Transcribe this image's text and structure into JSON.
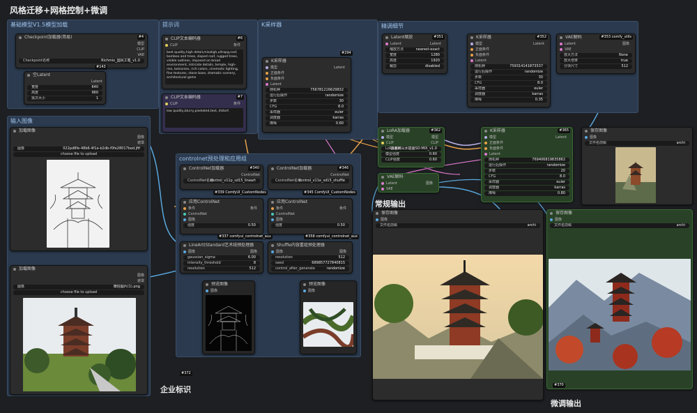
{
  "title": "风格迁移+网格控制+微调",
  "captions": {
    "regular_output": "常规输出",
    "finetune_output": "微调输出",
    "enterprise_logo": "企业标识"
  },
  "groups": {
    "base_model": "基础模型V1.5模型加载",
    "prompt": "提示词",
    "ksampler": "K采样器",
    "input_image": "输入图像",
    "controlnet": "controlnet预处理和应用组",
    "finetune": "精调细节"
  },
  "nodes": {
    "ckpt": {
      "title": "Checkpoint加载器(简易)",
      "badge": "#4",
      "out1": "模型",
      "out2": "CLIP",
      "out3": "VAE",
      "widget_label": "Checkpoint名称",
      "widget_value": "Richmix_国风工笔_v1.0"
    },
    "latent": {
      "title": "空Latent",
      "badge": "#143",
      "out": "Latent",
      "w_label": "宽度",
      "w_value": "640",
      "h_label": "高度",
      "h_value": "960",
      "b_label": "批次大小",
      "b_value": "1"
    },
    "clip_pos": {
      "title": "CLIP文本编码器",
      "badge": "#6",
      "in": "CLIP",
      "out": "条件",
      "text": "best quality,high detail,misaligh,ultrapg,roof, bamboo and trees, sloped roof, rugged trees, visible outlines, imposed on broad environment, intricate details, temple, high-rise, balconies, rich colors, cinematic lighting, fine textures, stone base, dramatic scenery, architectural gems"
    },
    "clip_neg": {
      "title": "CLIP文本编码器",
      "badge": "#7",
      "in": "CLIP",
      "out": "条件",
      "text": "low quality,blurry,pixelated,text, distort"
    },
    "ks1": {
      "title": "K采样器",
      "badge": "#294",
      "in1": "模型",
      "in2": "正面条件",
      "in3": "负面条件",
      "in4": "Latent",
      "out": "Latent",
      "w": [
        [
          "随机种",
          "756781216629832"
        ],
        [
          "运行后操作",
          "randomize"
        ],
        [
          "步数",
          "30"
        ],
        [
          "CFG",
          "8.0"
        ],
        [
          "采样器",
          "euler"
        ],
        [
          "调度器",
          "karras"
        ],
        [
          "降噪",
          "0.60"
        ]
      ]
    },
    "lora": {
      "title": "LoRA加载器",
      "badge": "#362",
      "in1": "模型",
      "in2": "CLIP",
      "out1": "模型",
      "out2": "CLIP",
      "w": [
        [
          "LoRA名称",
          "国潮风山水插画SD-MIX_v1.0"
        ],
        [
          "模型强度",
          "0.60"
        ],
        [
          "CLIP强度",
          "0.60"
        ]
      ]
    },
    "vae_dec1": {
      "title": "VAE解码",
      "badge": "#367",
      "in1": "Latent",
      "in2": "VAE",
      "out": "图像"
    },
    "upscale": {
      "title": "Latent缩放",
      "badge": "#351",
      "in": "Latent",
      "out": "Latent",
      "w": [
        [
          "缩放方法",
          "nearest-exact"
        ],
        [
          "宽度",
          "1280"
        ],
        [
          "高度",
          "1920"
        ],
        [
          "裁剪",
          "disabled"
        ]
      ]
    },
    "ks2": {
      "title": "K采样器",
      "badge": "#352",
      "in1": "模型",
      "in2": "正面条件",
      "in3": "负面条件",
      "in4": "Latent",
      "out": "Latent",
      "w": [
        [
          "随机种",
          "759314141873537"
        ],
        [
          "运行后操作",
          "randomize"
        ],
        [
          "步数",
          "30"
        ],
        [
          "CFG",
          "8.0"
        ],
        [
          "采样器",
          "euler"
        ],
        [
          "调度器",
          "karras"
        ],
        [
          "降噪",
          "0.35"
        ]
      ]
    },
    "vae_dec2": {
      "title": "VAE解码",
      "badge": "#353 comfy_utils",
      "in1": "Latent",
      "in2": "VAE",
      "out": "图像",
      "w": [
        [
          "放大方法",
          "None"
        ],
        [
          "放大倍率",
          "true"
        ],
        [
          "分块尺寸",
          "512"
        ]
      ]
    },
    "ks3": {
      "title": "K采样器",
      "badge": "#365",
      "in1": "模型",
      "in2": "正面条件",
      "in3": "负面条件",
      "in4": "Latent",
      "out": "Latent",
      "w": [
        [
          "随机种",
          "769406819835862"
        ],
        [
          "运行后操作",
          "randomize"
        ],
        [
          "步数",
          "20"
        ],
        [
          "CFG",
          "8.0"
        ],
        [
          "采样器",
          "euler"
        ],
        [
          "调度器",
          "karras"
        ],
        [
          "降噪",
          "0.80"
        ]
      ]
    },
    "preview_small": {
      "title": "保存图像",
      "badge": "#354",
      "in": "图像",
      "w_label": "文件名前缀",
      "w_value": "archi"
    },
    "load1": {
      "title": "加载图像",
      "badge": "#336",
      "out1": "图像",
      "out2": "遮罩",
      "w_label": "图像",
      "w_value": "022pd8fe-48b6-4f1e-b2db-f0fe28017bed.jfif",
      "upload": "choose file to upload"
    },
    "load2": {
      "title": "加载图像",
      "badge": "#344",
      "out1": "图像",
      "out2": "遮罩",
      "w_label": "图像",
      "w_value": "微信图片(1).png",
      "upload": "choose file to upload"
    },
    "cn_load1": {
      "title": "ControlNet加载器",
      "badge": "#340",
      "out": "ControlNet",
      "w_label": "ControlNet名称",
      "w_value": "control_v11p_sd15_lineart",
      "sub": "#339 ComfyUI_CustomNodes"
    },
    "cn_load2": {
      "title": "ControlNet加载器",
      "badge": "#346",
      "out": "ControlNet",
      "w_label": "ControlNet名称",
      "w_value": "control_v11e_sd15_shuffle",
      "sub": "#345 ComfyUI_CustomNodes"
    },
    "cn_apply1": {
      "title": "应用ControlNet",
      "in1": "条件",
      "in2": "ControlNet",
      "in3": "图像",
      "out": "条件",
      "w": [
        [
          "强度",
          "0.50"
        ],
        [
          "开始时间",
          "0.000"
        ],
        [
          "结束时间",
          "1.000"
        ]
      ],
      "sub": "#337 comfyui_controlnet_aux"
    },
    "cn_apply2": {
      "title": "应用ControlNet",
      "in1": "条件",
      "in2": "ControlNet",
      "in3": "图像",
      "out": "条件",
      "w": [
        [
          "强度",
          "0.50"
        ],
        [
          "开始时间",
          "0.000"
        ],
        [
          "结束时间",
          "1.000"
        ]
      ],
      "sub": "#358 comfyui_controlnet_aux"
    },
    "lineart": {
      "title": "LineArt(Standard艺术线预处理器",
      "in": "图像",
      "out": "图像",
      "w": [
        [
          "gaussian_sigma",
          "6.00"
        ],
        [
          "intensity_threshold",
          "8"
        ],
        [
          "resolution",
          "512"
        ]
      ]
    },
    "shuffle": {
      "title": "Shuffle内容重组预处理器",
      "in": "图像",
      "out": "图像",
      "w": [
        [
          "resolution",
          "512"
        ],
        [
          "seed",
          "689857727840815"
        ],
        [
          "control_after_generate",
          "randomize"
        ]
      ]
    },
    "prev1": {
      "title": "预览图像",
      "badge": "#361",
      "in": "图像"
    },
    "prev2": {
      "title": "预览图像",
      "badge": "#359",
      "in": "图像"
    },
    "save_big1": {
      "title": "保存图像",
      "badge": "#309",
      "in": "图像",
      "w_label": "文件名前缀",
      "w_value": "archi"
    },
    "save_big2": {
      "title": "保存图像",
      "badge": "#360",
      "in": "图像",
      "w_label": "文件名前缀",
      "w_value": "archi",
      "footer": "#370"
    }
  },
  "misc_badges": {
    "n372": "#372",
    "n373": "#373"
  },
  "colors": {
    "bg": "#1d1f22",
    "group": "#2b3a4e",
    "node": "#2c2c2c",
    "wire_orange": "#e8a14a",
    "wire_pink": "#e07ad0",
    "wire_blue": "#5aa8e0",
    "wire_yellow": "#e6d05a",
    "wire_green": "#7ec97a"
  }
}
